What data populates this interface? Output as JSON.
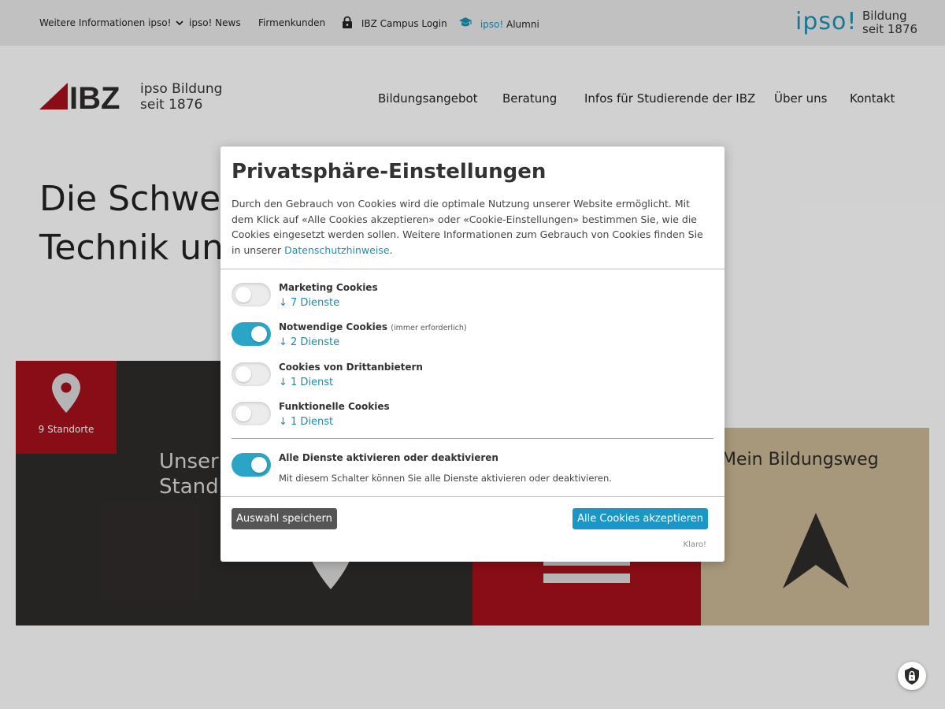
{
  "topbar": {
    "more_info": "Weitere Informationen ipso!",
    "news": "ipso! News",
    "business": "Firmenkunden",
    "campus_login": "IBZ Campus Login",
    "alumni_prefix": "ipso!",
    "alumni": "Alumni",
    "brand_word": "ipso!",
    "brand_line1": "Bildung",
    "brand_line2": "seit 1876"
  },
  "header": {
    "logo_text": "IBZ",
    "logo_sub_line1": "ipso Bildung",
    "logo_sub_line2": "seit 1876",
    "nav": [
      "Bildungsangebot",
      "Beratung",
      "Infos für Studierende der IBZ",
      "Über uns",
      "Kontakt"
    ]
  },
  "hero": {
    "title_line1": "Die Schwei",
    "title_line2": "Technik un"
  },
  "tiles": {
    "locations_count": "9 Standorte",
    "dark_line1": "Unser",
    "dark_line2": "Stand",
    "path_title": "Mein Bildungsweg"
  },
  "consent": {
    "title": "Privatsphäre-Einstellungen",
    "description": "Durch den Gebrauch von Cookies wird die optimale Nutzung unserer Website ermöglicht. Mit dem Klick auf «Alle Cookies akzeptieren» oder «Cookie-Einstellungen» bestimmen Sie, wie die Cookies eingesetzt werden sollen. Weitere Informationen zum Gebrauch von Cookies finden Sie in unserer",
    "privacy_link": "Datenschutzhinweise",
    "privacy_suffix": ".",
    "services": [
      {
        "name": "Marketing Cookies",
        "note": "",
        "count": "↓ 7 Dienste",
        "enabled": false
      },
      {
        "name": "Notwendige Cookies",
        "note": "(immer erforderlich)",
        "count": "↓ 2 Dienste",
        "enabled": true
      },
      {
        "name": "Cookies von Drittanbietern",
        "note": "",
        "count": "↓ 1 Dienst",
        "enabled": false
      },
      {
        "name": "Funktionelle Cookies",
        "note": "",
        "count": "↓ 1 Dienst",
        "enabled": false
      }
    ],
    "toggle_all": {
      "name": "Alle Dienste aktivieren oder deaktivieren",
      "description": "Mit diesem Schalter können Sie alle Dienste aktivieren oder deaktivieren.",
      "enabled": true
    },
    "save_button": "Auswahl speichern",
    "accept_button": "Alle Cookies akzeptieren",
    "klaro_link": "Klaro!"
  },
  "colors": {
    "accent": "#1a97c7",
    "toggle_on": "#2aa5c6",
    "ibz_red": "#a3101b",
    "dark_tile": "#2e2b2a",
    "beige_tile": "#c9b693"
  }
}
